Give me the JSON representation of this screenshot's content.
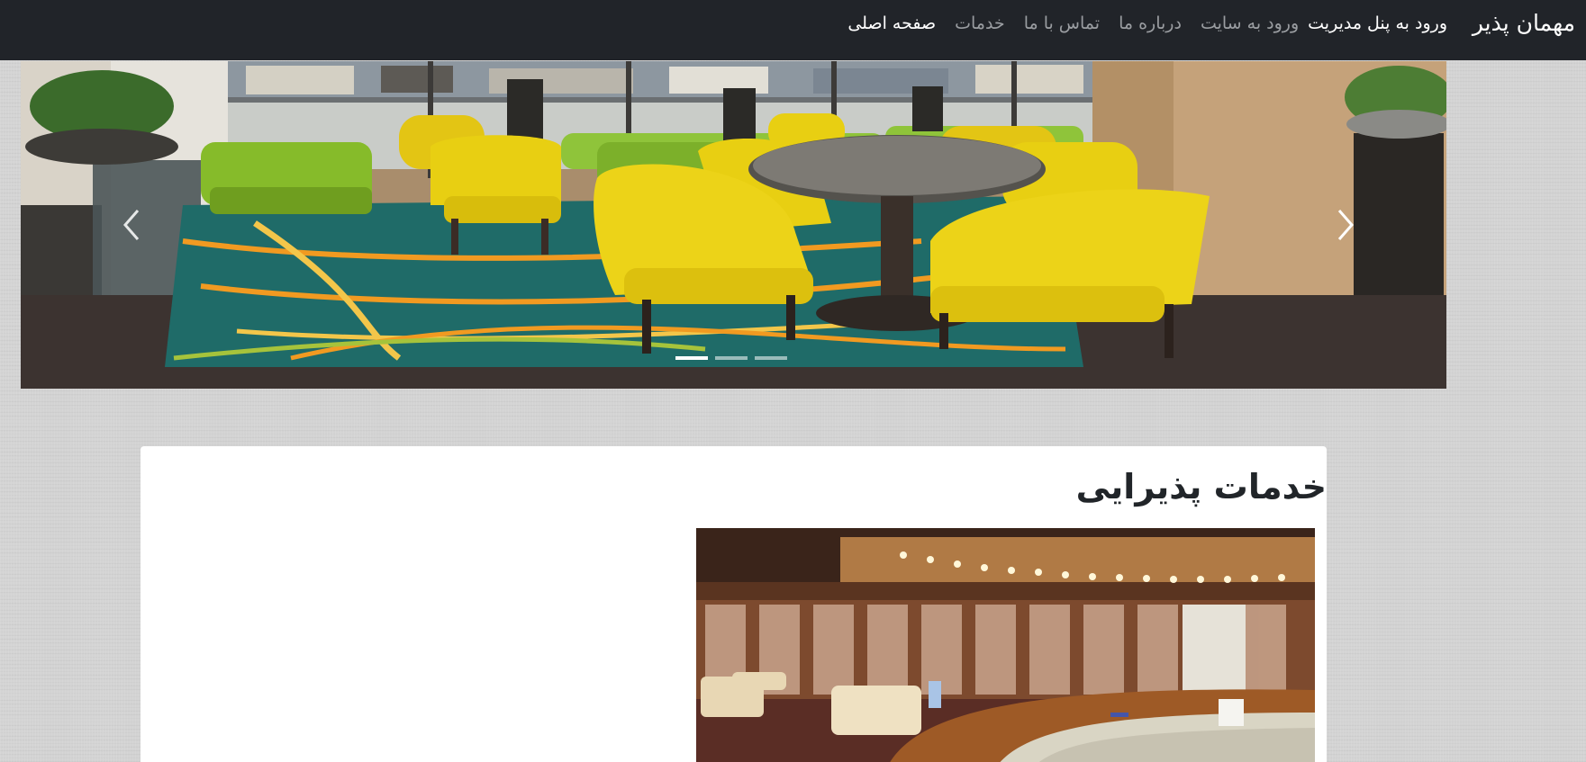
{
  "navbar": {
    "brand": "مهمان پذیر",
    "items": [
      {
        "label": "صفحه اصلی",
        "active": true
      },
      {
        "label": "خدمات",
        "active": false
      },
      {
        "label": "تماس با ما",
        "active": false
      },
      {
        "label": "درباره ما",
        "active": false
      },
      {
        "label": "ورود به سایت",
        "active": false
      }
    ],
    "admin_label": "ورود به پنل مدیریت"
  },
  "carousel": {
    "slide_count": 3,
    "active_slide": 1,
    "prev_icon": "chevron-left-icon",
    "next_icon": "chevron-right-icon"
  },
  "services": {
    "title": "خدمات پذیرایی"
  },
  "colors": {
    "navbar_bg": "#212429",
    "nav_inactive": "#9a9da1",
    "nav_active": "#ffffff",
    "page_bg": "#d3d3d3",
    "chair_yellow": "#e8cf12",
    "sofa_green": "#86bb2a",
    "carpet_teal": "#1f6b68",
    "carpet_orange": "#f19a21"
  }
}
